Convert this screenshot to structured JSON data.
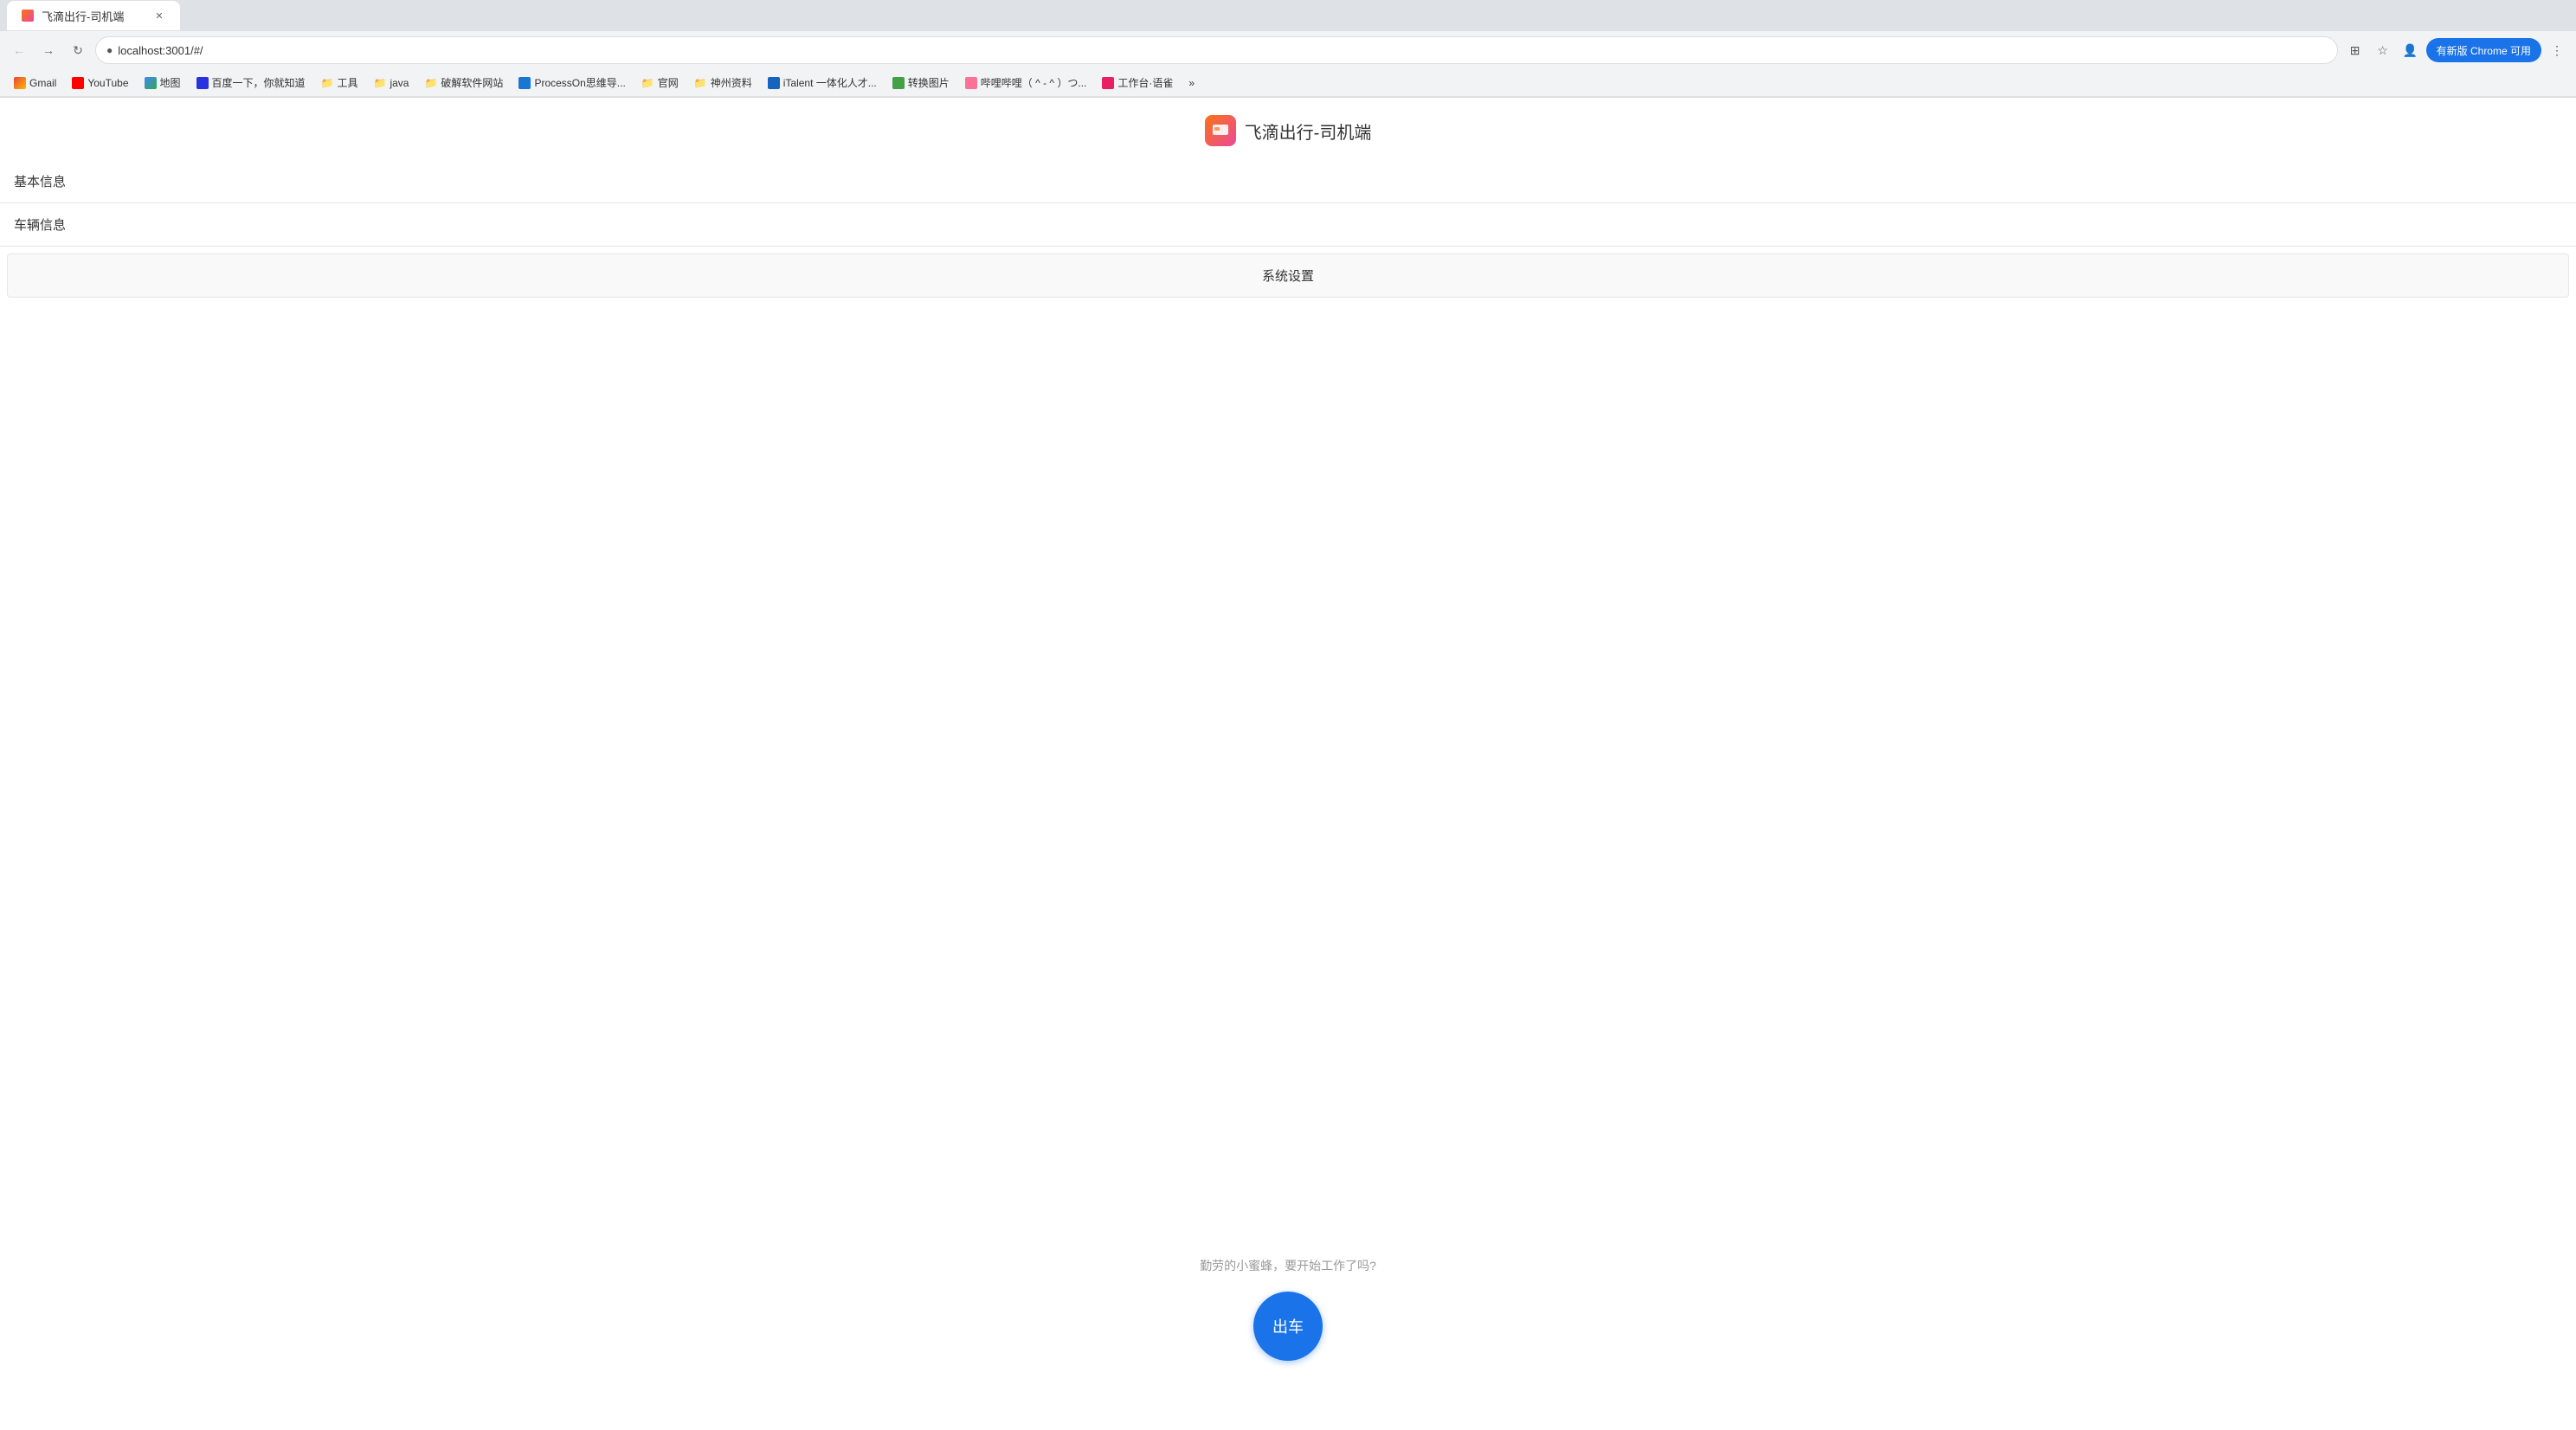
{
  "browser": {
    "tab_title": "飞滴出行-司机端",
    "address": "localhost:3001/#/",
    "update_label": "有新版 Chrome 可用"
  },
  "bookmarks": [
    {
      "id": "gmail",
      "label": "Gmail",
      "type": "link",
      "favicon_class": "bm-gmail"
    },
    {
      "id": "youtube",
      "label": "YouTube",
      "type": "link",
      "favicon_class": "bm-youtube"
    },
    {
      "id": "maps",
      "label": "地图",
      "type": "link",
      "favicon_class": "bm-maps"
    },
    {
      "id": "baidu",
      "label": "百度一下，你就知道",
      "type": "link",
      "favicon_class": "bm-baidu"
    },
    {
      "id": "tools",
      "label": "工具",
      "type": "folder",
      "favicon_class": ""
    },
    {
      "id": "java",
      "label": "java",
      "type": "folder",
      "favicon_class": ""
    },
    {
      "id": "crack",
      "label": "破解软件网站",
      "type": "folder",
      "favicon_class": ""
    },
    {
      "id": "processon",
      "label": "ProcessOn思维导...",
      "type": "link",
      "favicon_class": "bm-processon"
    },
    {
      "id": "shenzhou",
      "label": "神州资料",
      "type": "folder",
      "favicon_class": ""
    },
    {
      "id": "italent",
      "label": "iTalent 一体化人才...",
      "type": "link",
      "favicon_class": "bm-italent"
    },
    {
      "id": "convert",
      "label": "转换图片",
      "type": "link",
      "favicon_class": "bm-convert"
    },
    {
      "id": "bilibili",
      "label": "哔哩哔哩（ ^ - ^ ）つ...",
      "type": "link",
      "favicon_class": "bm-bilibili"
    },
    {
      "id": "work",
      "label": "工作台·语雀",
      "type": "link",
      "favicon_class": "bm-work"
    }
  ],
  "app": {
    "logo_icon": "🚗",
    "title": "飞滴出行-司机端",
    "menu_items": [
      {
        "id": "basic-info",
        "label": "基本信息"
      },
      {
        "id": "vehicle-info",
        "label": "车辆信息"
      }
    ],
    "system_settings_label": "系统设置",
    "tagline": "勤劳的小蜜蜂，要开始工作了吗?",
    "start_btn_label": "出车"
  }
}
